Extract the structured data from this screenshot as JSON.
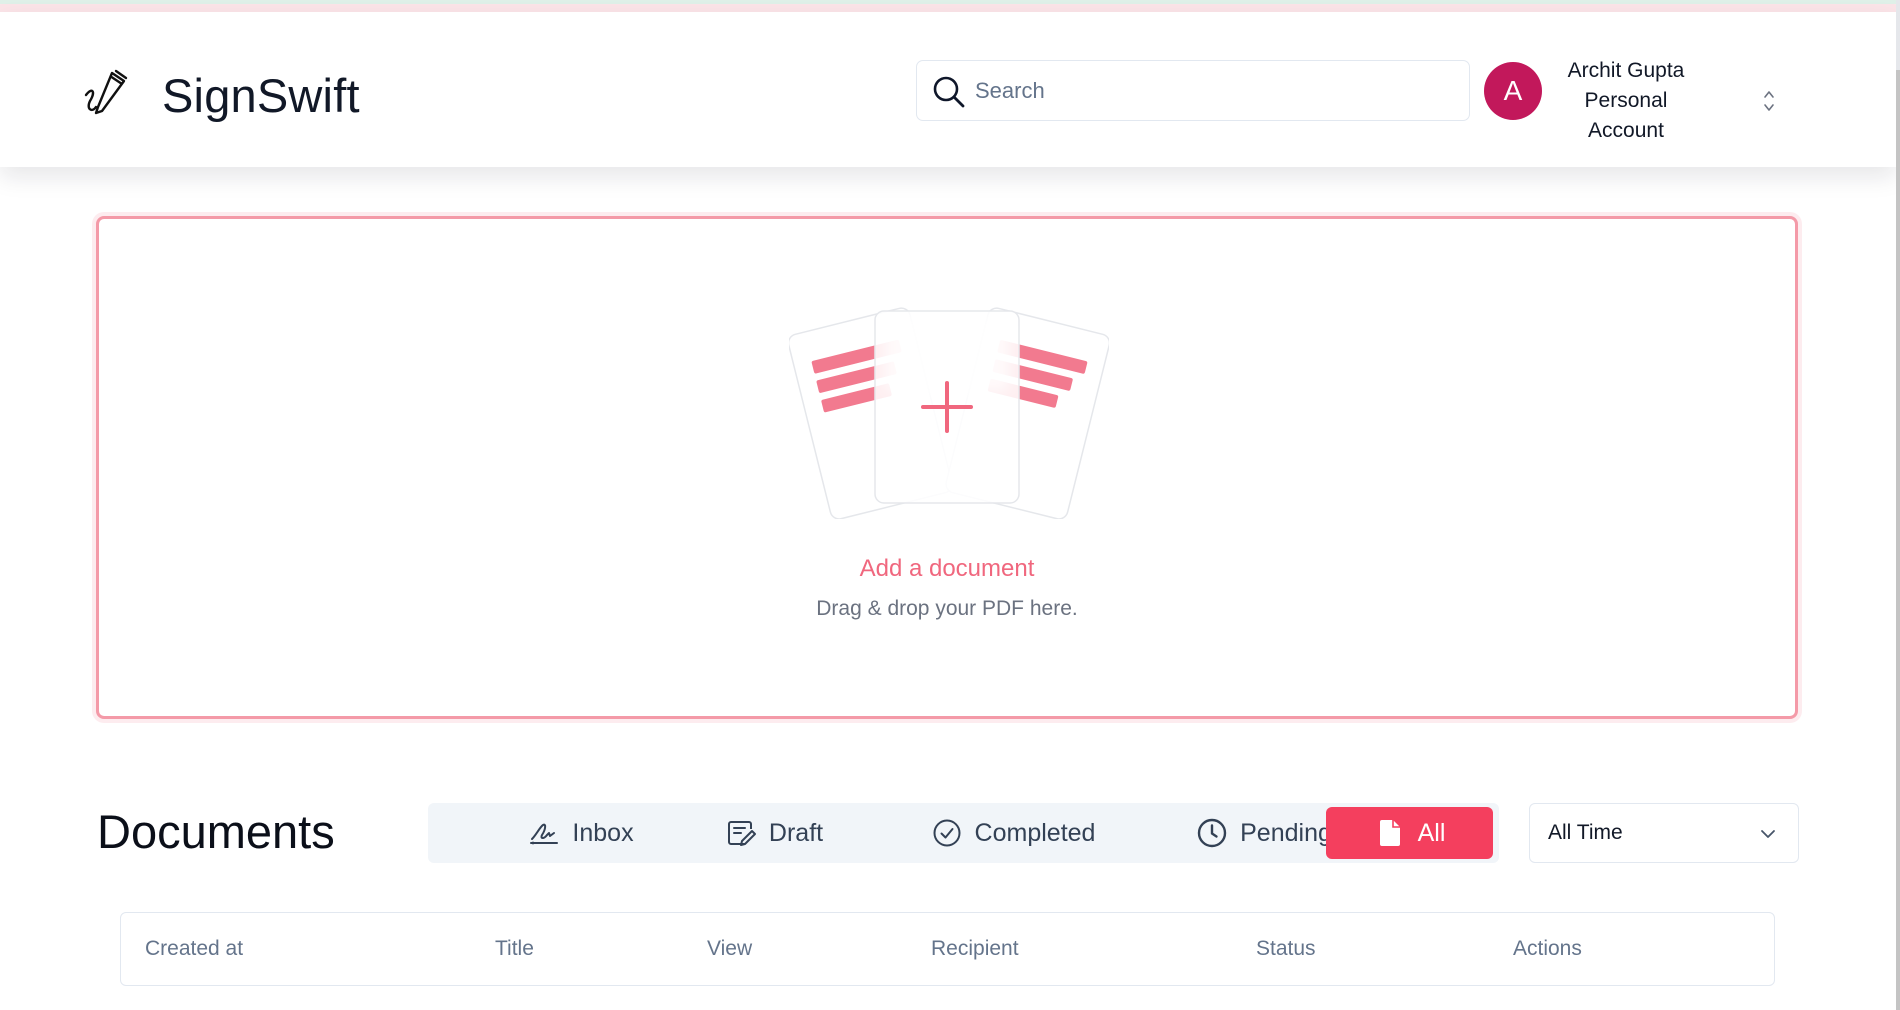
{
  "app": {
    "name": "SignSwift"
  },
  "search": {
    "placeholder": "Search"
  },
  "account": {
    "avatar_initial": "A",
    "name": "Archit Gupta",
    "type_line1": "Personal",
    "type_line2": "Account"
  },
  "upload": {
    "title": "Add a document",
    "subtitle": "Drag & drop your PDF here."
  },
  "documents": {
    "title": "Documents",
    "tabs": [
      {
        "label": "Inbox",
        "icon": "signature-icon",
        "active": false
      },
      {
        "label": "Draft",
        "icon": "draft-icon",
        "active": false
      },
      {
        "label": "Completed",
        "icon": "check-circle-icon",
        "active": false
      },
      {
        "label": "Pending",
        "icon": "clock-icon",
        "active": false
      },
      {
        "label": "All",
        "icon": "file-icon",
        "active": true
      }
    ],
    "period_filter": "All Time",
    "columns": [
      "Created at",
      "Title",
      "View",
      "Recipient",
      "Status",
      "Actions"
    ]
  },
  "colors": {
    "accent": "#f43f5e",
    "avatar": "#c2185b",
    "dropzone_border": "#f49aa8",
    "title_pink": "#f0677e"
  }
}
